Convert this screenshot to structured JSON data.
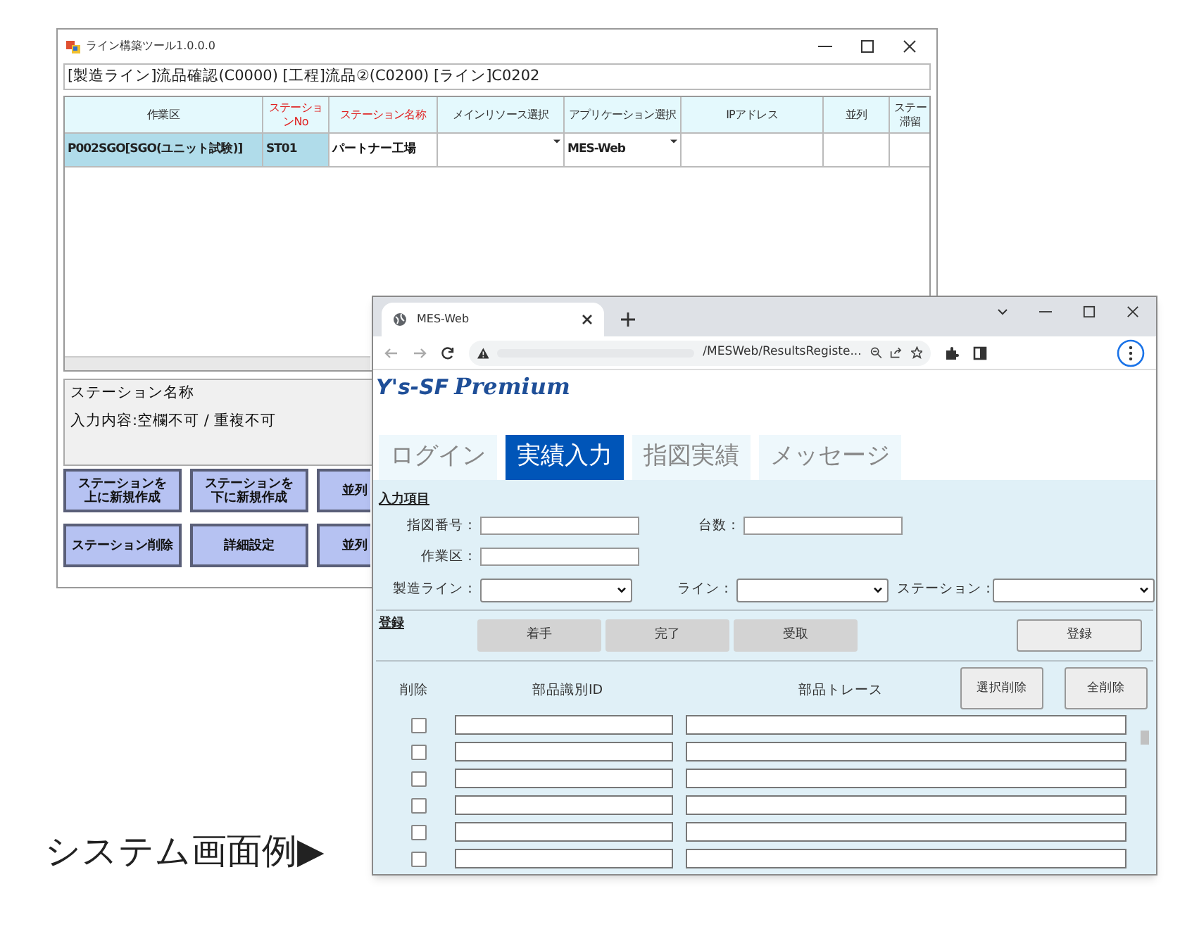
{
  "back_window": {
    "title": "ライン構築ツール1.0.0.0",
    "breadcrumb": "[製造ライン]流品確認(C0000) [工程]流品②(C0200) [ライン]C0202",
    "table": {
      "columns": [
        {
          "lines": [
            "作業区"
          ],
          "color": "#333333"
        },
        {
          "lines": [
            "ステーショ",
            "ンNo"
          ],
          "color": "#e02020"
        },
        {
          "lines": [
            "ステーション名称"
          ],
          "color": "#e02020"
        },
        {
          "lines": [
            "メインリソース選択"
          ],
          "color": "#333333"
        },
        {
          "lines": [
            "アプリケーション選択"
          ],
          "color": "#333333"
        },
        {
          "lines": [
            "IPアドレス"
          ],
          "color": "#333333"
        },
        {
          "lines": [
            "並列"
          ],
          "color": "#333333"
        },
        {
          "lines": [
            "ステー",
            "滞留"
          ],
          "color": "#333333"
        }
      ],
      "rows": [
        {
          "cells": [
            {
              "kind": "readonly",
              "text": "P002SGO[SGO(ユニット試験)]"
            },
            {
              "kind": "readonly",
              "text": "ST01"
            },
            {
              "kind": "text",
              "text": "パートナー工場"
            },
            {
              "kind": "dropdown"
            },
            {
              "kind": "dropdown",
              "text": "MES-Web"
            },
            {
              "kind": "text"
            },
            {
              "kind": "text"
            },
            {
              "kind": "text"
            }
          ]
        }
      ]
    },
    "info": {
      "title": "ステーション名称",
      "text": "入力内容:空欄不可 / 重複不可"
    },
    "buttons": [
      {
        "lines": [
          "ステーションを",
          "上に新規作成"
        ]
      },
      {
        "lines": [
          "ステーションを",
          "下に新規作成"
        ]
      },
      {
        "lines": [
          "並列"
        ]
      },
      {
        "lines": [
          "ステーション削除"
        ]
      },
      {
        "lines": [
          "詳細設定"
        ]
      },
      {
        "lines": [
          "並列"
        ]
      }
    ]
  },
  "browser": {
    "tab": {
      "title": "MES-Web"
    },
    "address": "/MESWeb/ResultsRegiste...",
    "logo": {
      "brand": "Y's-SF",
      "product": "Premium"
    },
    "nav_tabs": [
      {
        "label": "ログイン",
        "selected": false
      },
      {
        "label": "実績入力",
        "selected": true
      },
      {
        "label": "指図実績",
        "selected": false
      },
      {
        "label": "メッセージ",
        "selected": false
      }
    ],
    "input_section": {
      "title": "入力項目",
      "rows": [
        [
          {
            "label": "指図番号：",
            "kind": "text"
          },
          {
            "label": "台数：",
            "kind": "text"
          }
        ],
        [
          {
            "label": "作業区：",
            "kind": "text"
          }
        ],
        [
          {
            "label": "製造ライン：",
            "kind": "select"
          },
          {
            "label": "ライン：",
            "kind": "select"
          },
          {
            "label": "ステーション：",
            "kind": "select"
          }
        ]
      ]
    },
    "register_section": {
      "title": "登録",
      "actions": [
        "着手",
        "完了",
        "受取"
      ],
      "submit": "登録"
    },
    "parts": {
      "columns": [
        "削除",
        "部品識別ID",
        "部品トレース"
      ],
      "buttons": [
        "選択削除",
        "全削除"
      ],
      "rows": [
        {
          "checked": false
        },
        {
          "checked": false
        },
        {
          "checked": false
        },
        {
          "checked": false
        },
        {
          "checked": false
        },
        {
          "checked": false
        }
      ]
    }
  },
  "caption": "システム画面例▶"
}
